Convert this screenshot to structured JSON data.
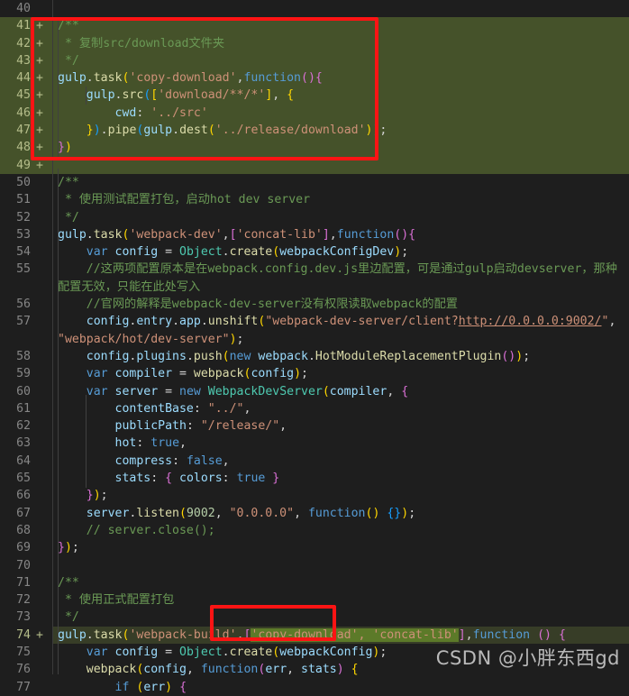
{
  "editor": {
    "first_line": 40,
    "last_line": 77,
    "watermark": "CSDN @小胖东西gd",
    "colors": {
      "background": "#1e1e1e",
      "added_line_background": "#45522a",
      "modified_line_background": "#373d27",
      "inline_added_token_background": "#5c7a29",
      "annotation_box_border": "#fc1414",
      "line_number": "#868686",
      "comment": "#6a9955",
      "string": "#ce9178",
      "keyword": "#569cd6",
      "variable": "#9cdcfe",
      "number": "#b5cea8"
    },
    "annotations": [
      {
        "name": "copy-download-task-box",
        "target_lines": "41-49"
      },
      {
        "name": "copy-download-dependency-box",
        "target_lines": "74"
      }
    ],
    "lines": [
      {
        "n": 40,
        "marker": "",
        "state": "normal",
        "text": ""
      },
      {
        "n": 41,
        "marker": "+",
        "state": "added",
        "text": "/**"
      },
      {
        "n": 42,
        "marker": "+",
        "state": "added",
        "text": " * 复制src/download文件夹"
      },
      {
        "n": 43,
        "marker": "+",
        "state": "added",
        "text": " */"
      },
      {
        "n": 44,
        "marker": "+",
        "state": "added",
        "text": "gulp.task('copy-download',function(){"
      },
      {
        "n": 45,
        "marker": "+",
        "state": "added",
        "text": "    gulp.src(['download/**/*'], {"
      },
      {
        "n": 46,
        "marker": "+",
        "state": "added",
        "text": "        cwd: '../src'"
      },
      {
        "n": 47,
        "marker": "+",
        "state": "added",
        "text": "    }).pipe(gulp.dest('../release/download'));"
      },
      {
        "n": 48,
        "marker": "+",
        "state": "added",
        "text": "})"
      },
      {
        "n": 49,
        "marker": "+",
        "state": "added",
        "text": ""
      },
      {
        "n": 50,
        "marker": "",
        "state": "normal",
        "text": "/**"
      },
      {
        "n": 51,
        "marker": "",
        "state": "normal",
        "text": " * 使用测试配置打包，启动hot dev server"
      },
      {
        "n": 52,
        "marker": "",
        "state": "normal",
        "text": " */"
      },
      {
        "n": 53,
        "marker": "",
        "state": "normal",
        "text": "gulp.task('webpack-dev',['concat-lib'],function(){"
      },
      {
        "n": 54,
        "marker": "",
        "state": "normal",
        "text": "    var config = Object.create(webpackConfigDev);"
      },
      {
        "n": 55,
        "marker": "",
        "state": "normal",
        "text": "    //这两项配置原本是在webpack.config.dev.js里边配置，可是通过gulp启动devserver，那种配置无效，只能在此处写入"
      },
      {
        "n": 56,
        "marker": "",
        "state": "normal",
        "text": "    //官网的解释是webpack-dev-server没有权限读取webpack的配置"
      },
      {
        "n": 57,
        "marker": "",
        "state": "normal",
        "text": "    config.entry.app.unshift(\"webpack-dev-server/client?http://0.0.0.0:9002/\", \"webpack/hot/dev-server\");"
      },
      {
        "n": 58,
        "marker": "",
        "state": "normal",
        "text": "    config.plugins.push(new webpack.HotModuleReplacementPlugin());"
      },
      {
        "n": 59,
        "marker": "",
        "state": "normal",
        "text": "    var compiler = webpack(config);"
      },
      {
        "n": 60,
        "marker": "",
        "state": "normal",
        "text": "    var server = new WebpackDevServer(compiler, {"
      },
      {
        "n": 61,
        "marker": "",
        "state": "normal",
        "text": "        contentBase: \"../\","
      },
      {
        "n": 62,
        "marker": "",
        "state": "normal",
        "text": "        publicPath: \"/release/\","
      },
      {
        "n": 63,
        "marker": "",
        "state": "normal",
        "text": "        hot: true,"
      },
      {
        "n": 64,
        "marker": "",
        "state": "normal",
        "text": "        compress: false,"
      },
      {
        "n": 65,
        "marker": "",
        "state": "normal",
        "text": "        stats: { colors: true }"
      },
      {
        "n": 66,
        "marker": "",
        "state": "normal",
        "text": "    });"
      },
      {
        "n": 67,
        "marker": "",
        "state": "normal",
        "text": "    server.listen(9002, \"0.0.0.0\", function() {});"
      },
      {
        "n": 68,
        "marker": "",
        "state": "normal",
        "text": "    // server.close();"
      },
      {
        "n": 69,
        "marker": "",
        "state": "normal",
        "text": "});"
      },
      {
        "n": 70,
        "marker": "",
        "state": "normal",
        "text": ""
      },
      {
        "n": 71,
        "marker": "",
        "state": "normal",
        "text": "/**"
      },
      {
        "n": 72,
        "marker": "",
        "state": "normal",
        "text": " * 使用正式配置打包"
      },
      {
        "n": 73,
        "marker": "",
        "state": "normal",
        "text": " */"
      },
      {
        "n": 74,
        "marker": "+",
        "state": "modified",
        "text": "gulp.task('webpack-build',['copy-download', 'concat-lib'],function () {"
      },
      {
        "n": 75,
        "marker": "",
        "state": "normal",
        "text": "    var config = Object.create(webpackConfig);"
      },
      {
        "n": 76,
        "marker": "",
        "state": "normal",
        "text": "    webpack(config, function(err, stats) {"
      },
      {
        "n": 77,
        "marker": "",
        "state": "normal",
        "text": "        if (err) {"
      }
    ]
  }
}
